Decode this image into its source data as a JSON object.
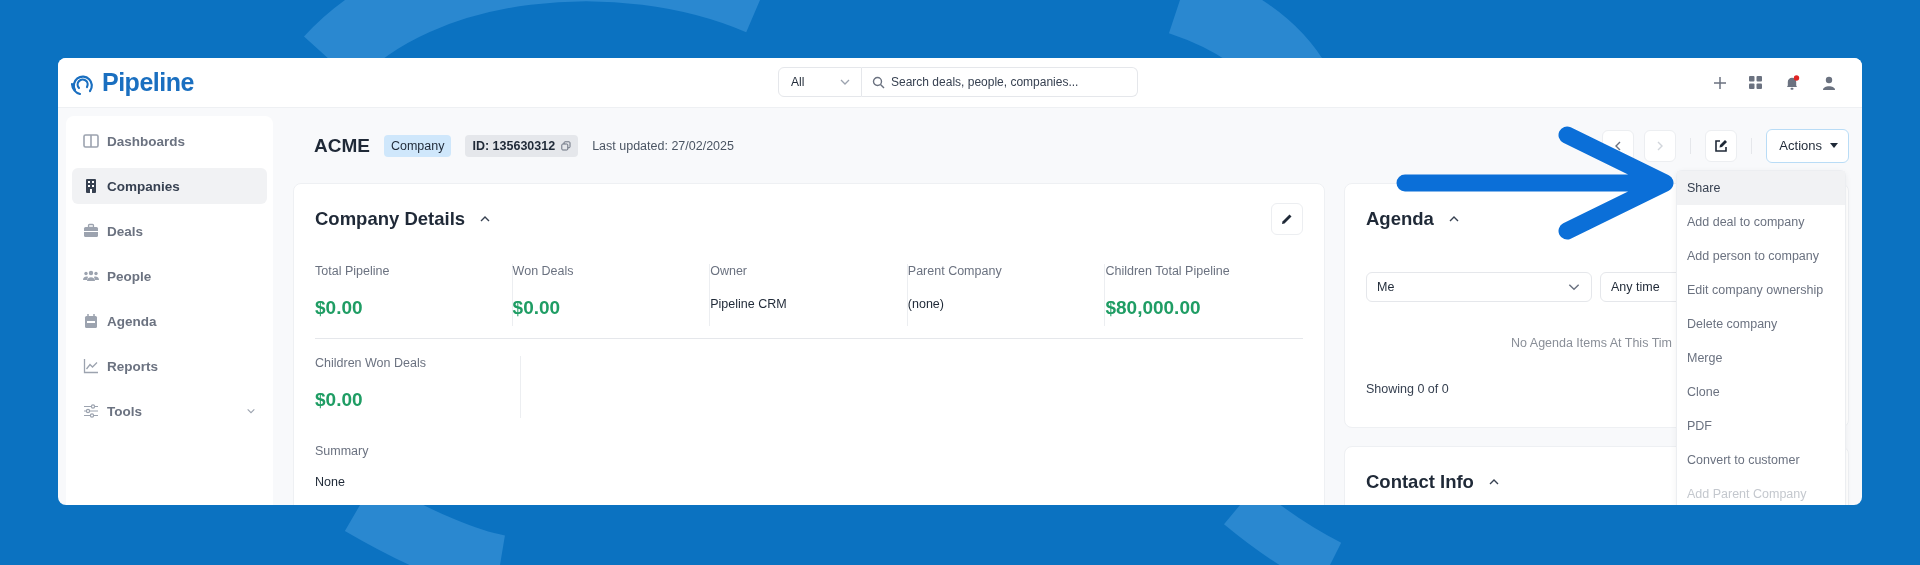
{
  "logo": {
    "text": "Pipeline"
  },
  "search": {
    "scope": "All",
    "placeholder": "Search deals, people, companies..."
  },
  "notifications": {
    "unread": true
  },
  "sidebar": {
    "items": [
      {
        "label": "Dashboards",
        "selected": false
      },
      {
        "label": "Companies",
        "selected": true
      },
      {
        "label": "Deals",
        "selected": false
      },
      {
        "label": "People",
        "selected": false
      },
      {
        "label": "Agenda",
        "selected": false
      },
      {
        "label": "Reports",
        "selected": false
      },
      {
        "label": "Tools",
        "selected": false,
        "expanded": false
      }
    ]
  },
  "header": {
    "title": "ACME",
    "type_badge": "Company",
    "id_badge": "ID: 135630312",
    "last_updated": "Last updated: 27/02/2025",
    "actions_button": "Actions"
  },
  "actions_menu": [
    {
      "label": "Share",
      "selected": true,
      "disabled": false
    },
    {
      "label": "Add deal to company",
      "selected": false,
      "disabled": false
    },
    {
      "label": "Add person to company",
      "selected": false,
      "disabled": false
    },
    {
      "label": "Edit company ownership",
      "selected": false,
      "disabled": false
    },
    {
      "label": "Delete company",
      "selected": false,
      "disabled": false
    },
    {
      "label": "Merge",
      "selected": false,
      "disabled": false
    },
    {
      "label": "Clone",
      "selected": false,
      "disabled": false
    },
    {
      "label": "PDF",
      "selected": false,
      "disabled": false
    },
    {
      "label": "Convert to customer",
      "selected": false,
      "disabled": false
    },
    {
      "label": "Add Parent Company",
      "selected": false,
      "disabled": true
    }
  ],
  "company_details": {
    "title": "Company Details",
    "expanded": true,
    "fields": [
      {
        "label": "Total Pipeline",
        "value": "$0.00",
        "kind": "money"
      },
      {
        "label": "Won Deals",
        "value": "$0.00",
        "kind": "money"
      },
      {
        "label": "Owner",
        "value": "Pipeline CRM",
        "kind": "text"
      },
      {
        "label": "Parent Company",
        "value": "(none)",
        "kind": "text"
      },
      {
        "label": "Children Total Pipeline",
        "value": "$80,000.00",
        "kind": "money"
      },
      {
        "label": "Children Won Deals",
        "value": "$0.00",
        "kind": "money"
      }
    ],
    "summary": {
      "label": "Summary",
      "value": "None"
    }
  },
  "agenda": {
    "title": "Agenda",
    "expanded": true,
    "owner_filter": "Me",
    "time_filter": "Any time",
    "empty_text": "No Agenda Items At This Tim",
    "footer": "Showing 0 of 0"
  },
  "contact_info": {
    "title": "Contact Info",
    "expanded": true
  }
}
